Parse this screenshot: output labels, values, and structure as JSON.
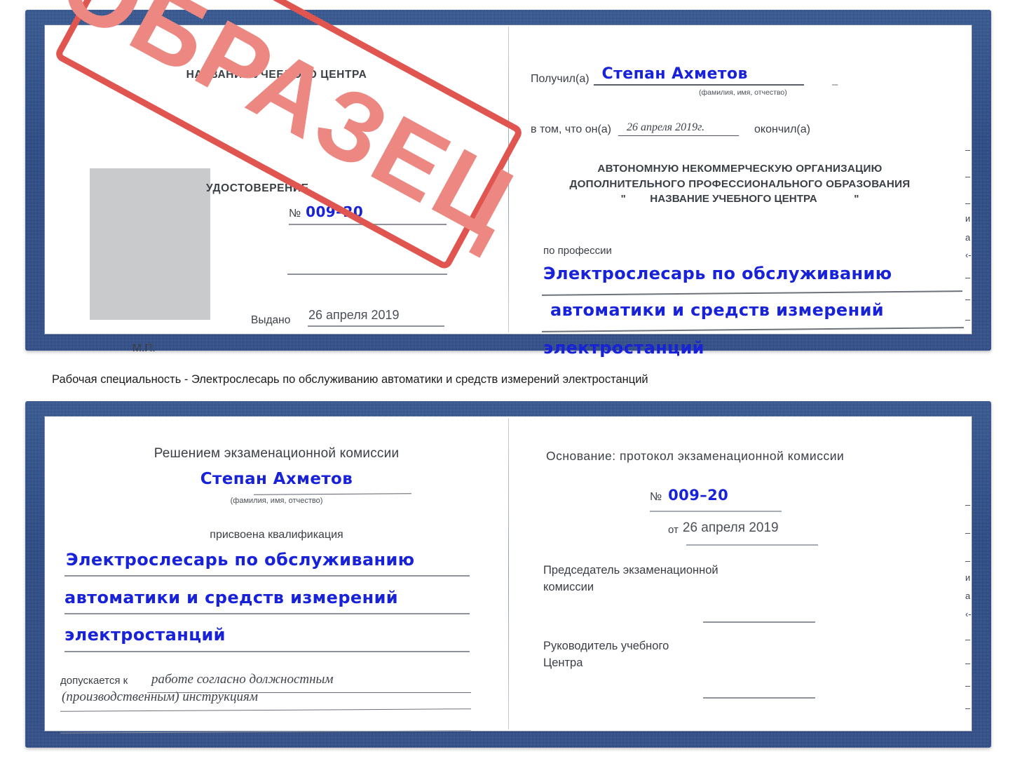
{
  "document": {
    "type": "certificate-scan",
    "watermark": "ОБРАЗЕЦ",
    "colors": {
      "cover_blue": "#27488c",
      "handwriting_blue": "#1822d8",
      "stamp_red": "#e0554f",
      "stamp_fill": "#ec8781",
      "photo_placeholder": "#c9cacc",
      "rule_gray": "#8e939b"
    }
  },
  "top_certificate": {
    "left_page": {
      "center_name": "НАЗВАНИЕ УЧЕБНОГО ЦЕНТРА",
      "doc_type": "УДОСТОВЕРЕНИЕ",
      "number_symbol": "№",
      "number_value": "009–20",
      "issued_label": "Выдано",
      "issued_date": "26 апреля 2019",
      "seal_label": "М.П.",
      "photo_placeholder_label": "photo-placeholder"
    },
    "right_page": {
      "received_label": "Получил(а)",
      "recipient_name": "Степан Ахметов",
      "fio_hint": "(фамилия, имя, отчество)",
      "stray_dash": "–",
      "in_that_label": "в том, что он(а)",
      "completion_date": "26 апреля 2019г.",
      "finished_label": "окончил(а)",
      "org_line1": "АВТОНОМНУЮ НЕКОММЕРЧЕСКУЮ ОРГАНИЗАЦИЮ",
      "org_line2": "ДОПОЛНИТЕЛЬНОГО ПРОФЕССИОНАЛЬНОГО ОБРАЗОВАНИЯ",
      "org_quote_open": "\"",
      "org_name": "НАЗВАНИЕ УЧЕБНОГО ЦЕНТРА",
      "org_quote_close": "\"",
      "profession_label": "по профессии",
      "profession_line1": "Электрослесарь по обслуживанию",
      "profession_line2": "автоматики и средств измерений",
      "profession_line3": "электростанций",
      "edge_fragments": [
        "–",
        "–",
        "–",
        "и",
        "а",
        "‹-",
        "–",
        "–",
        "–",
        "–"
      ]
    }
  },
  "caption": {
    "text": "Рабочая специальность - Электрослесарь по обслуживанию автоматики и средств измерений электростанций"
  },
  "bottom_certificate": {
    "left_page": {
      "heading": "Решением экзаменационной комиссии",
      "recipient_name": "Степан Ахметов",
      "fio_hint": "(фамилия, имя, отчество)",
      "qualification_label": "присвоена квалификация",
      "qualification_line1": "Электрослесарь по обслуживанию",
      "qualification_line2": "автоматики и средств измерений",
      "qualification_line3": "электростанций",
      "admitted_label": "допускается к",
      "admitted_line1": "работе согласно должностным",
      "admitted_line2": "(производственным) инструкциям"
    },
    "right_page": {
      "basis_label": "Основание: протокол экзаменационной комиссии",
      "number_symbol": "№",
      "number_value": "009–20",
      "date_prefix": "от",
      "date_value": "26 апреля 2019",
      "chairman_line1": "Председатель экзаменационной",
      "chairman_line2": "комиссии",
      "head_line1": "Руководитель учебного",
      "head_line2": "Центра",
      "edge_fragments": [
        "–",
        "–",
        "–",
        "и",
        "а",
        "‹-",
        "–",
        "–",
        "–",
        "–"
      ]
    }
  }
}
